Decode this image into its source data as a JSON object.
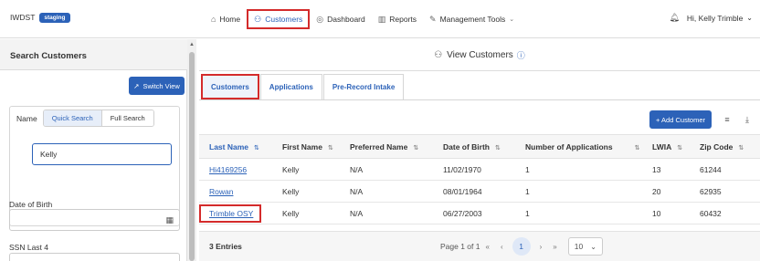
{
  "header": {
    "brand": "IWDST",
    "env_badge": "staging",
    "nav": [
      {
        "label": "Home",
        "icon": "home-icon"
      },
      {
        "label": "Customers",
        "icon": "customers-icon"
      },
      {
        "label": "Dashboard",
        "icon": "dashboard-icon"
      },
      {
        "label": "Reports",
        "icon": "reports-icon"
      },
      {
        "label": "Management Tools",
        "icon": "tools-icon"
      }
    ],
    "greeting": "Hi, Kelly Trimble"
  },
  "sidebar": {
    "title": "Search Customers",
    "switch_view": "Switch View",
    "name_label": "Name",
    "quick_search": "Quick Search",
    "full_search": "Full Search",
    "name_value": "Kelly",
    "dob_label": "Date of Birth",
    "ssn_label": "SSN Last 4"
  },
  "main": {
    "title": "View Customers",
    "tabs": [
      "Customers",
      "Applications",
      "Pre-Record Intake"
    ],
    "add_customer": "+ Add Customer",
    "columns": [
      "Last Name",
      "First Name",
      "Preferred Name",
      "Date of Birth",
      "Number of Applications",
      "LWIA",
      "Zip Code"
    ],
    "rows": [
      {
        "last": "Hi4169256",
        "first": "Kelly",
        "preferred": "N/A",
        "dob": "11/02/1970",
        "apps": "1",
        "lwia": "13",
        "zip": "61244"
      },
      {
        "last": "Rowan",
        "first": "Kelly",
        "preferred": "N/A",
        "dob": "08/01/1964",
        "apps": "1",
        "lwia": "20",
        "zip": "62935"
      },
      {
        "last": "Trimble OSY",
        "first": "Kelly",
        "preferred": "N/A",
        "dob": "06/27/2003",
        "apps": "1",
        "lwia": "10",
        "zip": "60432"
      }
    ],
    "entries": "3 Entries",
    "page_info": "Page 1 of 1",
    "current_page": "1",
    "per_page": "10"
  },
  "colors": {
    "accent": "#2c62b8",
    "highlight": "#d42b2b"
  }
}
